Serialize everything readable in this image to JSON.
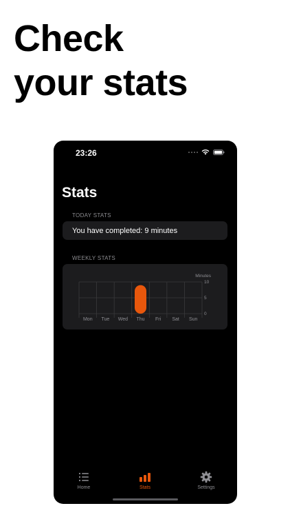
{
  "headline": {
    "line1": "Check",
    "line2": "your stats"
  },
  "status_bar": {
    "time": "23:26"
  },
  "screen": {
    "title": "Stats"
  },
  "today": {
    "section_label": "TODAY STATS",
    "text": "You have completed: 9 minutes"
  },
  "weekly": {
    "section_label": "WEEKLY STATS"
  },
  "chart_data": {
    "type": "bar",
    "categories": [
      "Mon",
      "Tue",
      "Wed",
      "Thu",
      "Fri",
      "Sat",
      "Sun"
    ],
    "values": [
      0,
      0,
      0,
      9,
      0,
      0,
      0
    ],
    "ylabel": "Minutes",
    "ylim": [
      0,
      10
    ],
    "yticks": [
      0,
      5,
      10
    ],
    "grid": true,
    "bar_color": "#e8570c"
  },
  "tabs": [
    {
      "label": "Home",
      "icon": "list-icon"
    },
    {
      "label": "Stats",
      "icon": "bar-chart-icon"
    },
    {
      "label": "Settings",
      "icon": "gear-icon"
    }
  ],
  "colors": {
    "accent": "#e8570c",
    "card": "#1c1c1e",
    "screen_background": "#000000",
    "muted_text": "#8e8e93"
  }
}
